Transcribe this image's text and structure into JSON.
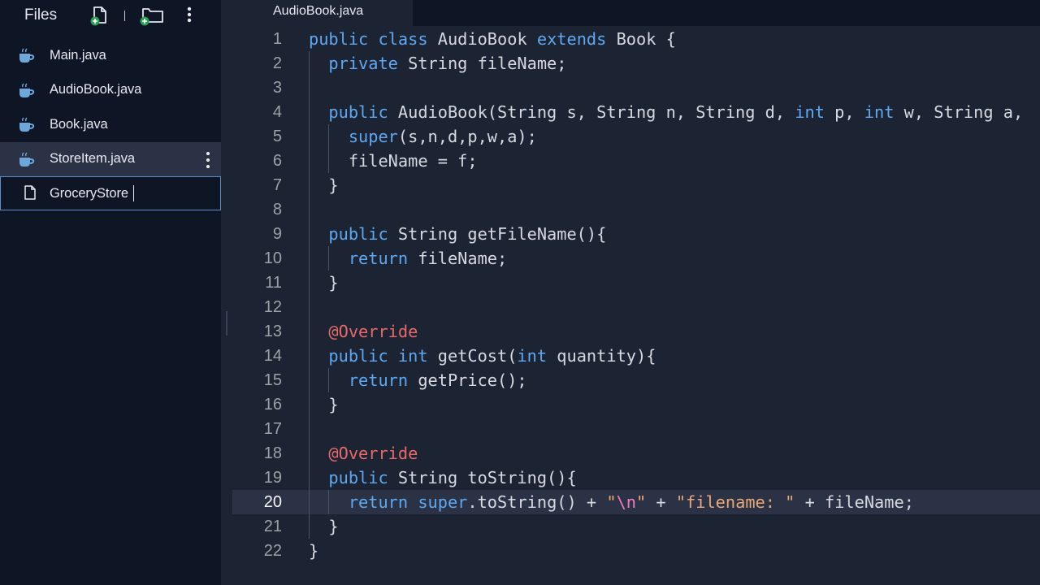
{
  "sidebar": {
    "title": "Files",
    "files": [
      {
        "name": "Main.java",
        "selected": false
      },
      {
        "name": "AudioBook.java",
        "selected": false
      },
      {
        "name": "Book.java",
        "selected": false
      },
      {
        "name": "StoreItem.java",
        "selected": true
      }
    ],
    "new_file_value": "GroceryStore"
  },
  "editor": {
    "tab_label": "AudioBook.java",
    "active_line": 20,
    "lines": [
      {
        "n": "1",
        "tokens": [
          [
            "kw",
            "public"
          ],
          [
            "p",
            " "
          ],
          [
            "kw",
            "class"
          ],
          [
            "p",
            " AudioBook "
          ],
          [
            "kw",
            "extends"
          ],
          [
            "p",
            " Book {"
          ]
        ]
      },
      {
        "n": "2",
        "tokens": [
          [
            "p",
            "  "
          ],
          [
            "kw",
            "private"
          ],
          [
            "p",
            " String fileName;"
          ]
        ]
      },
      {
        "n": "3",
        "tokens": []
      },
      {
        "n": "4",
        "tokens": [
          [
            "p",
            "  "
          ],
          [
            "kw",
            "public"
          ],
          [
            "p",
            " AudioBook(String s, String n, String d, "
          ],
          [
            "kw",
            "int"
          ],
          [
            "p",
            " p, "
          ],
          [
            "kw",
            "int"
          ],
          [
            "p",
            " w, String a,"
          ]
        ]
      },
      {
        "n": "5",
        "tokens": [
          [
            "p",
            "    "
          ],
          [
            "kw",
            "super"
          ],
          [
            "p",
            "(s,n,d,p,w,a);"
          ]
        ]
      },
      {
        "n": "6",
        "tokens": [
          [
            "p",
            "    fileName = f;"
          ]
        ]
      },
      {
        "n": "7",
        "tokens": [
          [
            "p",
            "  }"
          ]
        ]
      },
      {
        "n": "8",
        "tokens": []
      },
      {
        "n": "9",
        "tokens": [
          [
            "p",
            "  "
          ],
          [
            "kw",
            "public"
          ],
          [
            "p",
            " String getFileName(){"
          ]
        ]
      },
      {
        "n": "10",
        "tokens": [
          [
            "p",
            "    "
          ],
          [
            "kw",
            "return"
          ],
          [
            "p",
            " fileName;"
          ]
        ]
      },
      {
        "n": "11",
        "tokens": [
          [
            "p",
            "  }"
          ]
        ]
      },
      {
        "n": "12",
        "tokens": []
      },
      {
        "n": "13",
        "tokens": [
          [
            "p",
            "  "
          ],
          [
            "an",
            "@Override"
          ]
        ]
      },
      {
        "n": "14",
        "tokens": [
          [
            "p",
            "  "
          ],
          [
            "kw",
            "public"
          ],
          [
            "p",
            " "
          ],
          [
            "kw",
            "int"
          ],
          [
            "p",
            " getCost("
          ],
          [
            "kw",
            "int"
          ],
          [
            "p",
            " quantity){"
          ]
        ]
      },
      {
        "n": "15",
        "tokens": [
          [
            "p",
            "    "
          ],
          [
            "kw",
            "return"
          ],
          [
            "p",
            " getPrice();"
          ]
        ]
      },
      {
        "n": "16",
        "tokens": [
          [
            "p",
            "  }"
          ]
        ]
      },
      {
        "n": "17",
        "tokens": []
      },
      {
        "n": "18",
        "tokens": [
          [
            "p",
            "  "
          ],
          [
            "an",
            "@Override"
          ]
        ]
      },
      {
        "n": "19",
        "tokens": [
          [
            "p",
            "  "
          ],
          [
            "kw",
            "public"
          ],
          [
            "p",
            " String toString(){"
          ]
        ]
      },
      {
        "n": "20",
        "tokens": [
          [
            "p",
            "    "
          ],
          [
            "kw",
            "return"
          ],
          [
            "p",
            " "
          ],
          [
            "kw",
            "super"
          ],
          [
            "p",
            ".toString() + "
          ],
          [
            "st",
            "\""
          ],
          [
            "es",
            "\\n"
          ],
          [
            "st",
            "\""
          ],
          [
            "p",
            " + "
          ],
          [
            "st",
            "\"filename: \""
          ],
          [
            "p",
            " + fileName;"
          ]
        ]
      },
      {
        "n": "21",
        "tokens": [
          [
            "p",
            "  }"
          ]
        ]
      },
      {
        "n": "22",
        "tokens": [
          [
            "p",
            "}"
          ]
        ]
      }
    ]
  },
  "colors": {
    "sidebar_bg": "#0e1525",
    "editor_bg": "#1c2333",
    "selected_bg": "#2b3245",
    "keyword": "#5fa8f0",
    "annotation": "#e66a6a",
    "string": "#e8a878",
    "escape": "#f07ac0",
    "input_border": "#5f8fc9"
  }
}
